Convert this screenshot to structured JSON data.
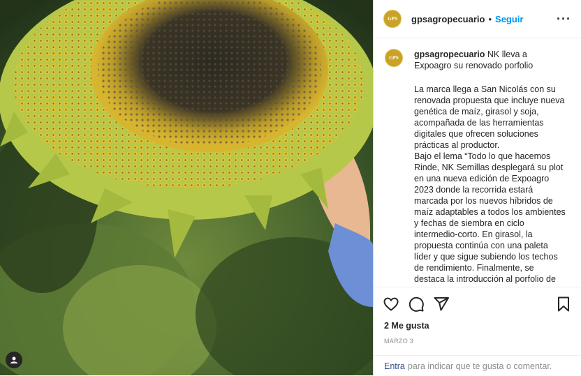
{
  "post": {
    "username": "gpsagropecuario",
    "avatar_text": "GPS",
    "follow_label": "Seguir",
    "separator": "•",
    "more_label": "···",
    "caption_title": "NK lleva a Expoagro su renovado porfolio",
    "caption_body": "La marca llega a San Nicolás con su renovada propuesta que incluye nueva genética de maíz, girasol y soja, acompañada de las herramientas digitales que ofrecen soluciones prácticas al productor.\nBajo el lema “Todo lo que hacemos Rinde, NK Semillas desplegará su plot en una nueva edición de Expoagro 2023 donde la recorrida estará marcada por los nuevos híbridos de maíz adaptables a todos los ambientes y fechas de siembra en ciclo intermedio-corto. En girasol, la propuesta continúa con una paleta líder y que sigue subiendo los techos de rendimiento. Finalmente, se destaca la introducción al porfolio de",
    "likes": "2 Me gusta",
    "date": "MARZO 3",
    "login_link": "Entra",
    "login_text": "para indicar que te gusta o comentar."
  },
  "icons": {
    "like": "heart-icon",
    "comment": "comment-icon",
    "share": "send-icon",
    "save": "bookmark-icon",
    "tags": "user-tag-icon"
  },
  "colors": {
    "accent": "#0095f6",
    "link": "#385185",
    "muted": "#8e8e8e"
  }
}
